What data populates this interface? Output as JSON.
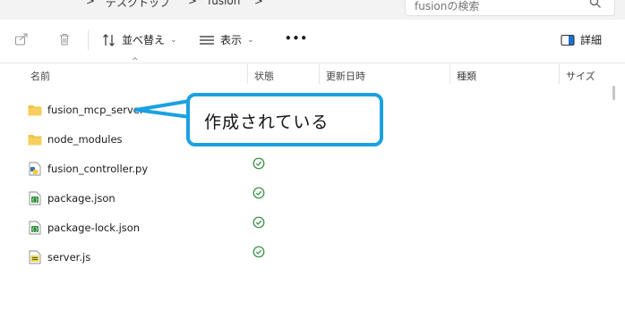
{
  "topbar": {
    "breadcrumb_sep_1": ">",
    "breadcrumb_desktop": "デスクトップ",
    "breadcrumb_sep_2": ">",
    "breadcrumb_folder": "fusion",
    "breadcrumb_sep_3": ">",
    "search_placeholder": "fusionの検索"
  },
  "toolbar": {
    "sort_label": "並べ替え",
    "view_label": "表示",
    "more_label": "•••",
    "details_label": "詳細"
  },
  "columns": {
    "name": "名前",
    "status": "状態",
    "modified": "更新日時",
    "type": "種類",
    "size": "サイズ"
  },
  "files": [
    {
      "name": "fusion_mcp_server",
      "icon": "folder-icon",
      "status": ""
    },
    {
      "name": "node_modules",
      "icon": "folder-icon",
      "status": ""
    },
    {
      "name": "fusion_controller.py",
      "icon": "python-file-icon",
      "status": "synced"
    },
    {
      "name": "package.json",
      "icon": "json-file-icon",
      "status": "synced"
    },
    {
      "name": "package-lock.json",
      "icon": "json-file-icon",
      "status": "synced"
    },
    {
      "name": "server.js",
      "icon": "js-file-icon",
      "status": "synced"
    }
  ],
  "callout": {
    "text": "作成されている"
  },
  "colors": {
    "callout_border": "#1ba1e2",
    "folder": "#f0c24a",
    "status_check": "#2e8b3d"
  }
}
